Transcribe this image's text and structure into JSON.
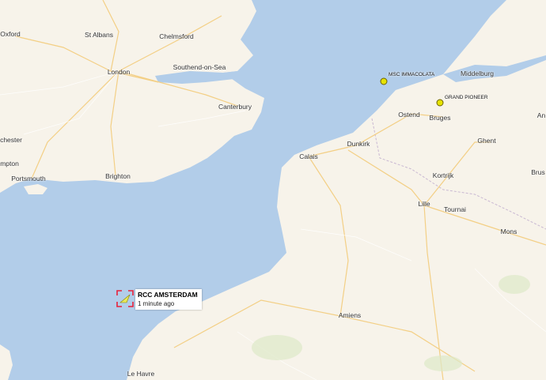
{
  "map": {
    "colors": {
      "sea": "#b2cde9",
      "land": "#f7f3ea",
      "road_major": "#f6d58a",
      "road_minor": "#ffffff"
    },
    "cities": [
      {
        "id": "oxford",
        "name": "Oxford"
      },
      {
        "id": "st-albans",
        "name": "St Albans"
      },
      {
        "id": "chelmsford",
        "name": "Chelmsford"
      },
      {
        "id": "southend-on-sea",
        "name": "Southend-on-Sea"
      },
      {
        "id": "london",
        "name": "London"
      },
      {
        "id": "canterbury",
        "name": "Canterbury"
      },
      {
        "id": "chester",
        "name": "chester"
      },
      {
        "id": "mpton",
        "name": "mpton"
      },
      {
        "id": "portsmouth",
        "name": "Portsmouth"
      },
      {
        "id": "brighton",
        "name": "Brighton"
      },
      {
        "id": "middelburg",
        "name": "Middelburg"
      },
      {
        "id": "ostend",
        "name": "Ostend"
      },
      {
        "id": "bruges",
        "name": "Bruges"
      },
      {
        "id": "dunkirk",
        "name": "Dunkirk"
      },
      {
        "id": "calais",
        "name": "Calais"
      },
      {
        "id": "ghent",
        "name": "Ghent"
      },
      {
        "id": "kortrijk",
        "name": "Kortrijk"
      },
      {
        "id": "lille",
        "name": "Lille"
      },
      {
        "id": "tournai",
        "name": "Tournai"
      },
      {
        "id": "mons",
        "name": "Mons"
      },
      {
        "id": "amiens",
        "name": "Amiens"
      },
      {
        "id": "le-havre",
        "name": "Le Havre"
      },
      {
        "id": "brus",
        "name": "Brus"
      },
      {
        "id": "an",
        "name": "An"
      }
    ],
    "vessels": [
      {
        "id": "msc-immacolata",
        "name": "MSC IMMACOLATA",
        "color": "#e6e200"
      },
      {
        "id": "grand-pioneer",
        "name": "GRAND PIONEER",
        "color": "#e6e200"
      }
    ],
    "selected_vessel": {
      "name": "RCC AMSTERDAM",
      "last_seen": "1 minute ago",
      "marker_color": "#e8e85a",
      "bracket_color": "#e8213a"
    }
  }
}
